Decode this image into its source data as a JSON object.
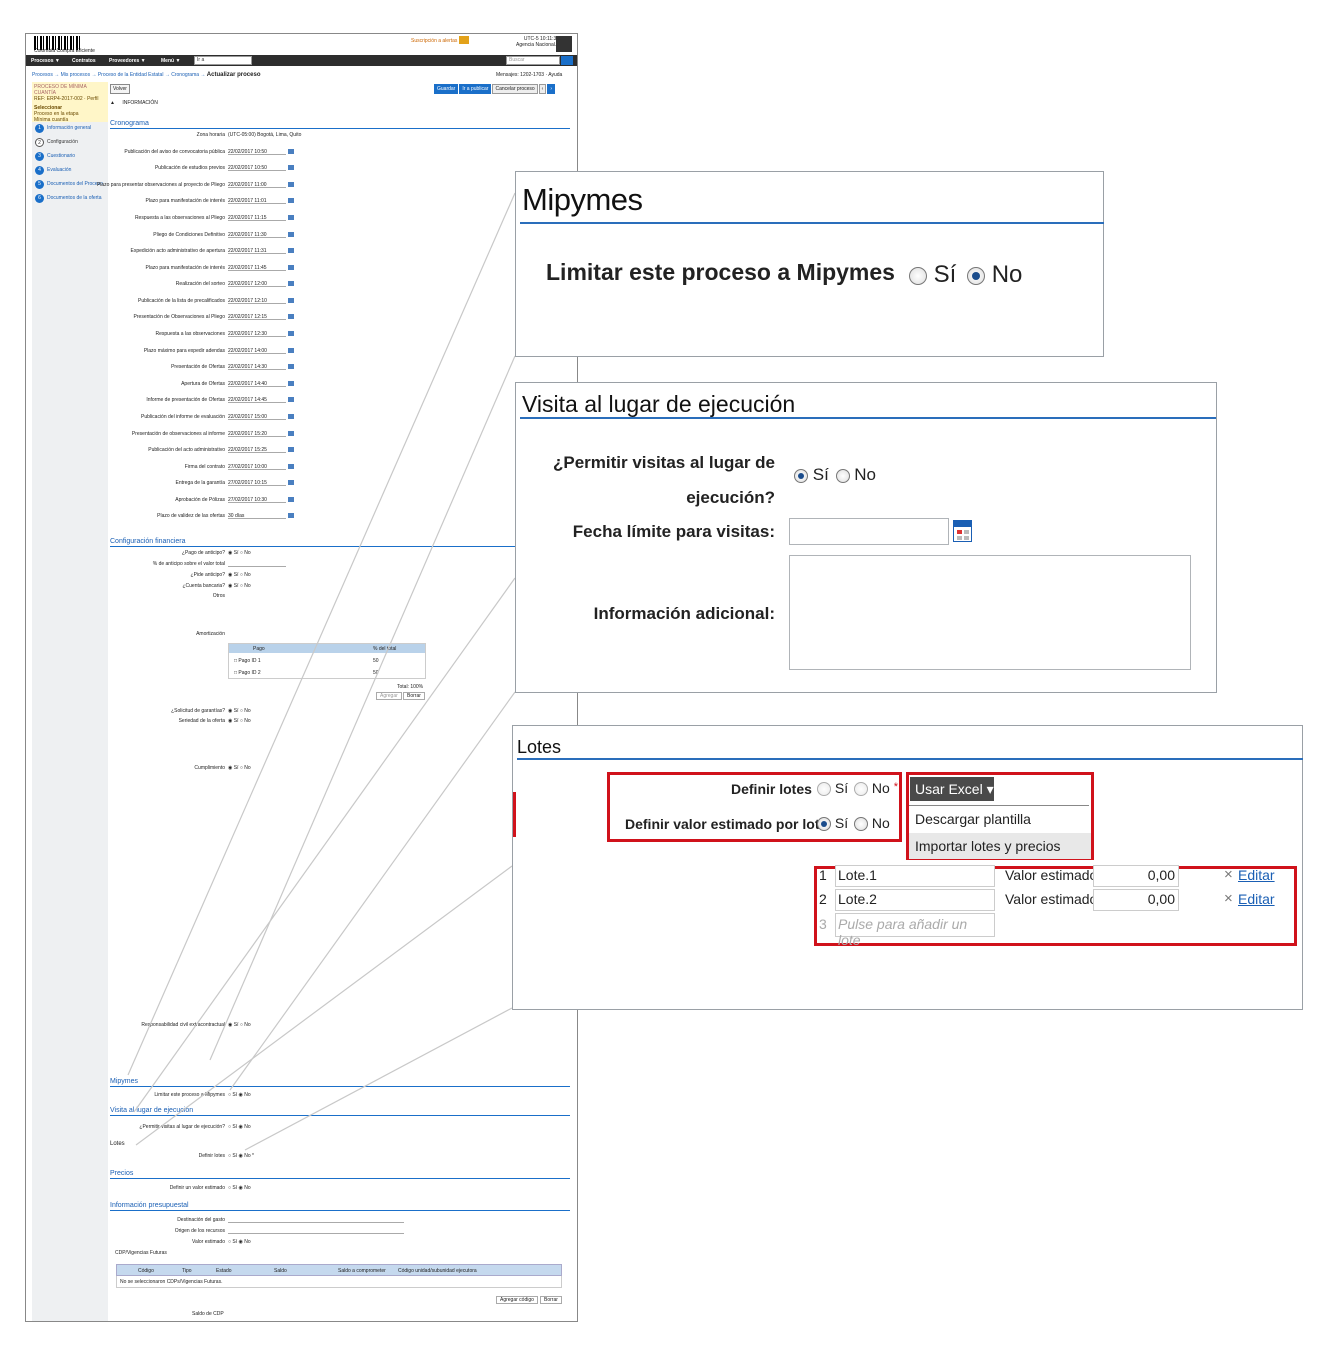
{
  "mini": {
    "logo_text": "Colombia Compra Eficiente",
    "top_links": "Suscripción a alertas",
    "session": "UTC-5 10:11:30",
    "user": "Agencia Nacional...",
    "menu": [
      "Procesos ▼",
      "Contratos",
      "Proveedores ▼",
      "Menú ▼"
    ],
    "goto_placeholder": "Ir a",
    "search_placeholder": "Buscar",
    "breadcrumb": "Procesos → Mis procesos → Proceso de la Entidad Estatal → Cronograma →",
    "page_title": "Actualizar proceso",
    "messages": "Mensajes: 1202-1703 · Ayuda",
    "process_box": [
      "PROCESO DE MÍNIMA CUANTÍA",
      "REF: ERP4-2017-002 · Perfil",
      "Seleccionar",
      "Proceso en la etapa",
      "Mínima cuantía"
    ],
    "nav": [
      {
        "num": "1",
        "label": "Información general"
      },
      {
        "num": "2",
        "label": "Configuración"
      },
      {
        "num": "3",
        "label": "Cuestionario"
      },
      {
        "num": "4",
        "label": "Evaluación"
      },
      {
        "num": "5",
        "label": "Documentos del Proceso"
      },
      {
        "num": "6",
        "label": "Documentos de la oferta"
      }
    ],
    "volver": "Volver",
    "buttons": [
      "Guardar",
      "Ir a publicar",
      "Cancelar proceso"
    ],
    "info_bar": "INFORMACIÓN",
    "sections": {
      "cronograma": "Cronograma",
      "financiera": "Configuración financiera",
      "mipymes": "Mipymes",
      "visita": "Visita al lugar de ejecución",
      "lotes": "Lotes",
      "precios": "Precios",
      "presupuestal": "Información presupuestal"
    },
    "crono_rows": [
      {
        "label": "Zona horaria",
        "value": "(UTC-05:00) Bogotá, Lima, Quito"
      },
      {
        "label": "Publicación del aviso de convocatoria pública",
        "value": "22/02/2017 10:50"
      },
      {
        "label": "Publicación de estudios previos",
        "value": "22/02/2017 10:50"
      },
      {
        "label": "Plazo para presentar observaciones al proyecto de Pliego",
        "value": "22/02/2017 11:00"
      },
      {
        "label": "Plazo para manifestación de interés",
        "value": "22/02/2017 11:01"
      },
      {
        "label": "Respuesta a las observaciones al Pliego",
        "value": "22/02/2017 11:15"
      },
      {
        "label": "Pliego de Condiciones Definitivo",
        "value": "22/02/2017 11:30"
      },
      {
        "label": "Expedición acto administrativo de apertura",
        "value": "22/02/2017 11:31"
      },
      {
        "label": "Plazo para manifestación de interés",
        "value": "22/02/2017 11:45"
      },
      {
        "label": "Realización del sorteo",
        "value": "22/02/2017 12:00"
      },
      {
        "label": "Publicación de la lista de precalificados",
        "value": "22/02/2017 12:10"
      },
      {
        "label": "Presentación de Observaciones al Pliego",
        "value": "22/02/2017 12:15"
      },
      {
        "label": "Respuesta a las observaciones",
        "value": "22/02/2017 12:30"
      },
      {
        "label": "Plazo máximo para expedir adendas",
        "value": "22/02/2017 14:00"
      },
      {
        "label": "Presentación de Ofertas",
        "value": "22/02/2017 14:30"
      },
      {
        "label": "Apertura de Ofertas",
        "value": "22/02/2017 14:40"
      },
      {
        "label": "Informe de presentación de Ofertas",
        "value": "22/02/2017 14:45"
      },
      {
        "label": "Publicación del informe de evaluación",
        "value": "22/02/2017 15:00"
      },
      {
        "label": "Presentación de observaciones al informe",
        "value": "22/02/2017 15:20"
      },
      {
        "label": "Publicación del acto administrativo",
        "value": "22/02/2017 15:25"
      },
      {
        "label": "Firma del contrato",
        "value": "27/02/2017 10:00"
      },
      {
        "label": "Entrega de la garantía",
        "value": "27/02/2017 10:15"
      },
      {
        "label": "Aprobación de Pólizas",
        "value": "27/02/2017 10:30"
      },
      {
        "label": "Plazo de validez de las ofertas",
        "value": "30 días"
      }
    ],
    "fin_rows": [
      "¿Pago de anticipo?",
      "% de anticipo sobre el valor total",
      "¿Pide anticipo?",
      "¿Cuenta bancaria?",
      "Otros",
      "Amortización",
      "¿Solicitud de garantías?",
      "Seriedad de la oferta",
      "Cumplimiento",
      "Responsabilidad civil extracontractual"
    ],
    "tbl_headers": [
      "Pago",
      "% del total"
    ],
    "tbl_rows": [
      [
        "Pago ID 1",
        "50"
      ],
      [
        "Pago ID 2",
        "50"
      ]
    ],
    "tbl_total": "Total: 100%",
    "mip_label": "Limitar este proceso a Mipymes",
    "vis_label": "¿Permitir visitas al lugar de ejecución?",
    "lot_label": "Definir lotes",
    "pre_label": "Definir un valor estimado",
    "pres_rows": [
      "Destinación del gasto",
      "Origen de los recursos",
      "Valor estimado",
      "CDP/Vigencias Futuras"
    ],
    "cdp_headers": [
      "Código",
      "Tipo",
      "Estado",
      "Saldo",
      "Saldo a comprometer",
      "Código unidad/subunidad ejecutora"
    ],
    "cdp_empty": "No se seleccionaron CDPs/Vigencias Futuras.",
    "cdp_btns": [
      "Agregar código",
      "Borrar"
    ],
    "cdp_total": "Saldo de CDP"
  },
  "mipymes": {
    "title": "Mipymes",
    "label": "Limitar este proceso a Mipymes",
    "opt_yes": "Sí",
    "opt_no": "No",
    "selected": "No"
  },
  "visita": {
    "title": "Visita al lugar de ejecución",
    "q_line1": "¿Permitir visitas al lugar de",
    "q_line2": "ejecución?",
    "opt_yes": "Sí",
    "opt_no": "No",
    "selected": "Sí",
    "fecha_label": "Fecha límite para visitas:",
    "fecha_value": "",
    "info_label": "Información adicional:",
    "info_value": "",
    "calendar_icon": "calendar-icon"
  },
  "lotes": {
    "title": "Lotes",
    "definir_label": "Definir lotes",
    "definir_yes": "Sí",
    "definir_no": "No",
    "required_mark": "*",
    "valor_label": "Definir valor estimado por lote",
    "valor_yes": "Sí",
    "valor_no": "No",
    "excel_button": "Usar Excel",
    "menu": [
      "Descargar plantilla",
      "Importar lotes y precios"
    ],
    "rows": [
      {
        "num": "1",
        "name": "Lote.1",
        "valor_label": "Valor estimado:",
        "valor": "0,00",
        "edit": "Editar"
      },
      {
        "num": "2",
        "name": "Lote.2",
        "valor_label": "Valor estimado:",
        "valor": "0,00",
        "edit": "Editar"
      }
    ],
    "new_num": "3",
    "new_placeholder": "Pulse para añadir un lote"
  },
  "colors": {
    "accent": "#2a6ebb",
    "highlight": "#d0121b",
    "menubar": "#2d2d2d",
    "excel_button": "#4a4a4a"
  }
}
